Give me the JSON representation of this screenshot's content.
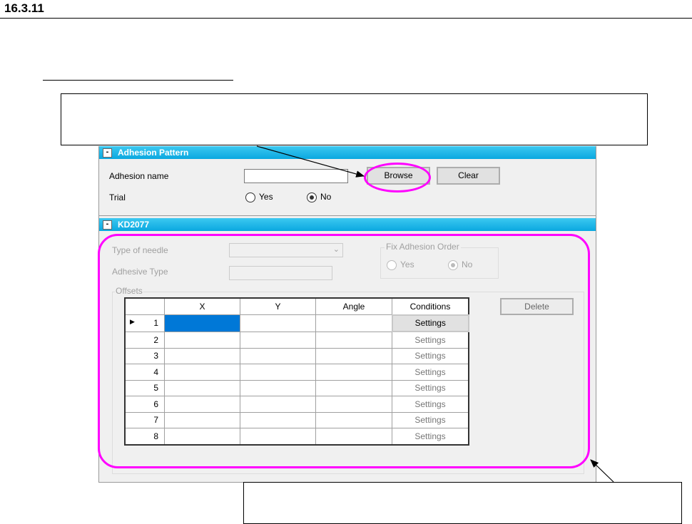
{
  "doc": {
    "section_number": "16.3.11"
  },
  "adhesion_pattern": {
    "header": "Adhesion Pattern",
    "toggle": "-",
    "name_label": "Adhesion name",
    "name_value": "",
    "browse": "Browse",
    "clear": "Clear",
    "trial_label": "Trial",
    "yes": "Yes",
    "no": "No",
    "trial_selected": "No"
  },
  "kd": {
    "header": "KD2077",
    "toggle": "-",
    "needle_label": "Type of needle",
    "adhesive_label": "Adhesive Type",
    "fix_order_label": "Fix Adhesion Order",
    "yes": "Yes",
    "no": "No",
    "fix_selected": "No",
    "offsets_label": "Offsets",
    "delete": "Delete",
    "columns": [
      "X",
      "Y",
      "Angle",
      "Conditions"
    ],
    "rows": [
      {
        "n": "1",
        "btn": "Settings"
      },
      {
        "n": "2",
        "btn": "Settings"
      },
      {
        "n": "3",
        "btn": "Settings"
      },
      {
        "n": "4",
        "btn": "Settings"
      },
      {
        "n": "5",
        "btn": "Settings"
      },
      {
        "n": "6",
        "btn": "Settings"
      },
      {
        "n": "7",
        "btn": "Settings"
      },
      {
        "n": "8",
        "btn": "Settings"
      }
    ]
  },
  "colors": {
    "header": "#0aa8e0",
    "highlight": "#ff00ff",
    "selection": "#0078d7"
  }
}
